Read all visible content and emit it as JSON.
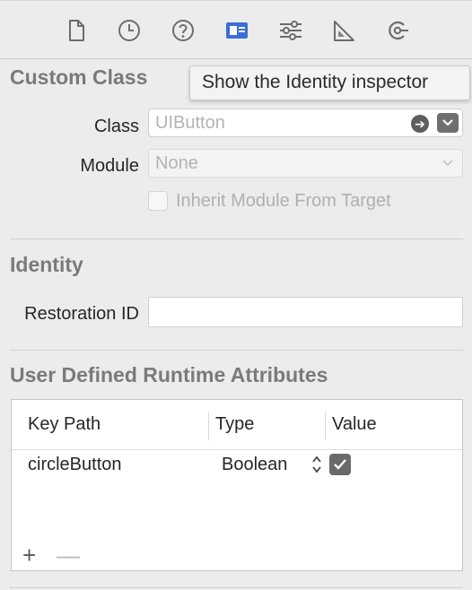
{
  "toolbar": {
    "icons": [
      "file-icon",
      "history-icon",
      "help-icon",
      "identity-icon",
      "attributes-icon",
      "size-icon",
      "connections-icon"
    ],
    "active_icon": "identity-icon",
    "accent_color": "#3b6fd6"
  },
  "tooltip": {
    "text": "Show the Identity inspector"
  },
  "custom_class": {
    "title": "Custom Class",
    "class_label": "Class",
    "class_placeholder": "UIButton",
    "module_label": "Module",
    "module_placeholder": "None",
    "inherit_label": "Inherit Module From Target",
    "inherit_checked": false
  },
  "identity": {
    "title": "Identity",
    "restoration_label": "Restoration ID",
    "restoration_value": ""
  },
  "runtime_attributes": {
    "title": "User Defined Runtime Attributes",
    "columns": [
      "Key Path",
      "Type",
      "Value"
    ],
    "rows": [
      {
        "key_path": "circleButton",
        "type": "Boolean",
        "value": true
      }
    ],
    "add_label": "+",
    "remove_label": "—"
  }
}
